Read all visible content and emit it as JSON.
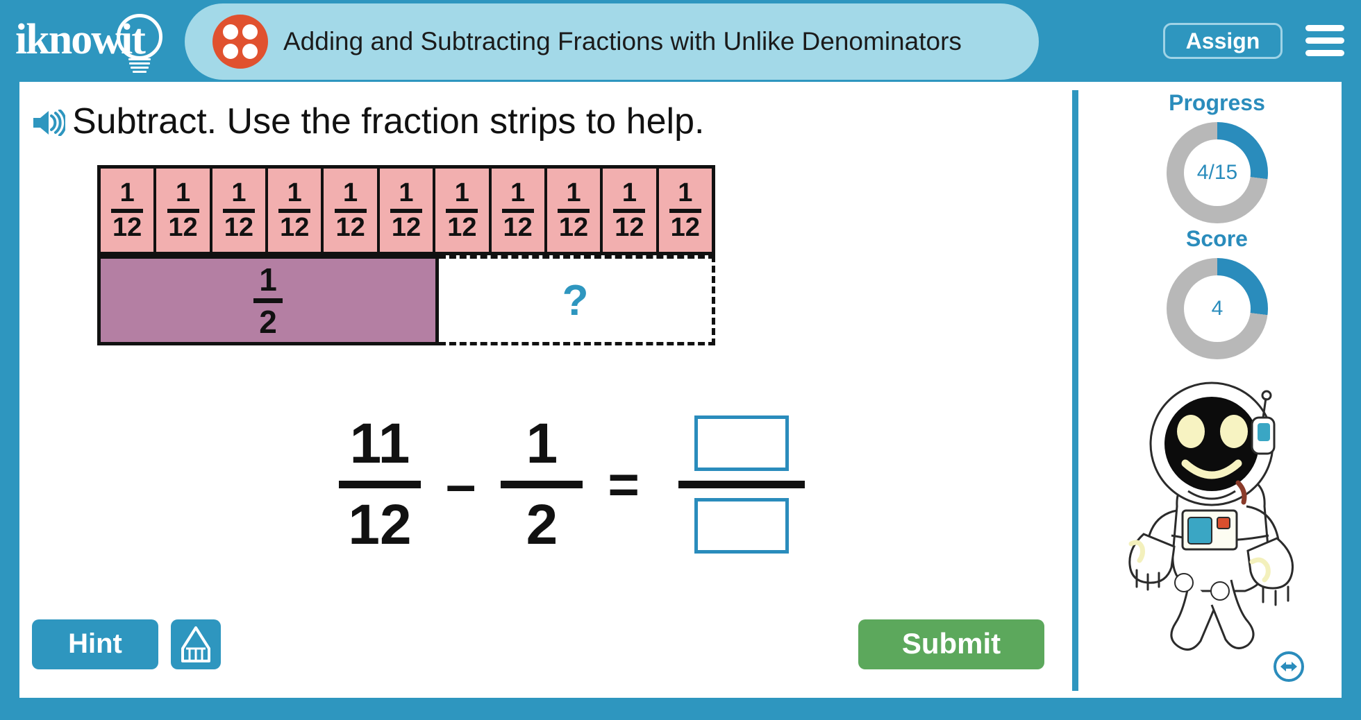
{
  "brand": {
    "name": "iknowit",
    "logo_icon": "lightbulb-icon"
  },
  "header": {
    "lesson_icon": "four-dot-circle-icon",
    "lesson_title": "Adding and Subtracting Fractions with Unlike Denominators",
    "assign_label": "Assign",
    "menu_icon": "hamburger-menu-icon",
    "bar_color": "#2e96bf",
    "pill_color": "#a3d9e8",
    "icon_color": "#e0512f"
  },
  "question": {
    "audio_icon": "speaker-icon",
    "prompt": "Subtract. Use the fraction strips to help."
  },
  "fraction_strips": {
    "top_row": {
      "count": 11,
      "numerator": "1",
      "denominator": "12",
      "fill_color": "#f2afaf"
    },
    "bottom_row": {
      "known": {
        "numerator": "1",
        "denominator": "2",
        "fill_color": "#b47fa3"
      },
      "unknown": {
        "symbol": "?",
        "symbol_color": "#2e96bf",
        "border_style": "dashed"
      }
    }
  },
  "equation": {
    "first": {
      "numerator": "11",
      "denominator": "12"
    },
    "operator": "–",
    "second": {
      "numerator": "1",
      "denominator": "2"
    },
    "equals": "=",
    "answer": {
      "numerator_value": "",
      "numerator_placeholder": "",
      "denominator_value": "",
      "denominator_placeholder": "",
      "box_border_color": "#2a8cbc"
    }
  },
  "actions": {
    "hint_label": "Hint",
    "pencil_icon": "pencil-icon",
    "submit_label": "Submit",
    "submit_color": "#5ca85c",
    "hint_color": "#2e96bf"
  },
  "sidebar": {
    "progress": {
      "label": "Progress",
      "value": "4/15",
      "completed": 4,
      "total": 15,
      "percent": 27,
      "fill_color": "#2a8cbc",
      "track_color": "#b8b8b8"
    },
    "score": {
      "label": "Score",
      "value": "4",
      "percent": 27,
      "fill_color": "#2a8cbc",
      "track_color": "#b8b8b8"
    },
    "mascot": "astronaut-mascot",
    "resize_icon": "resize-horizontal-icon"
  }
}
